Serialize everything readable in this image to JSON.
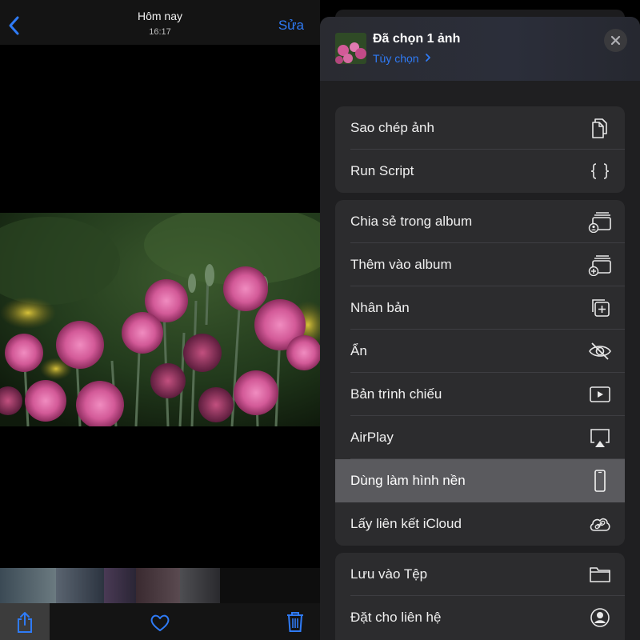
{
  "viewer": {
    "title": "Hôm nay",
    "time": "16:17",
    "edit_label": "Sửa",
    "back_icon": "chevron-left-icon",
    "toolbar": {
      "share_icon": "share-icon",
      "heart_icon": "heart-icon",
      "trash_icon": "trash-icon"
    }
  },
  "sheet": {
    "title": "Đã chọn 1 ảnh",
    "options_label": "Tùy chọn",
    "options_icon": "chevron-right-icon",
    "close_icon": "close-icon",
    "groups": [
      {
        "items": [
          {
            "label": "Sao chép ảnh",
            "icon": "copy-icon"
          },
          {
            "label": "Run Script",
            "icon": "braces-icon"
          }
        ]
      },
      {
        "items": [
          {
            "label": "Chia sẻ trong album",
            "icon": "shared-album-icon"
          },
          {
            "label": "Thêm vào album",
            "icon": "add-album-icon"
          },
          {
            "label": "Nhân bản",
            "icon": "duplicate-icon"
          },
          {
            "label": "Ẩn",
            "icon": "eye-slash-icon"
          },
          {
            "label": "Bản trình chiếu",
            "icon": "play-rectangle-icon"
          },
          {
            "label": "AirPlay",
            "icon": "airplay-icon"
          },
          {
            "label": "Dùng làm hình nền",
            "icon": "iphone-icon",
            "selected": true
          },
          {
            "label": "Lấy liên kết iCloud",
            "icon": "icloud-link-icon"
          }
        ]
      },
      {
        "items": [
          {
            "label": "Lưu vào Tệp",
            "icon": "folder-icon"
          },
          {
            "label": "Đặt cho liên hệ",
            "icon": "person-circle-icon"
          }
        ]
      }
    ]
  },
  "colors": {
    "accent": "#2f7bf6",
    "sheet_background": "#1f1f21",
    "group_background": "#2c2c2e",
    "selected_row": "#5a5a5e"
  }
}
